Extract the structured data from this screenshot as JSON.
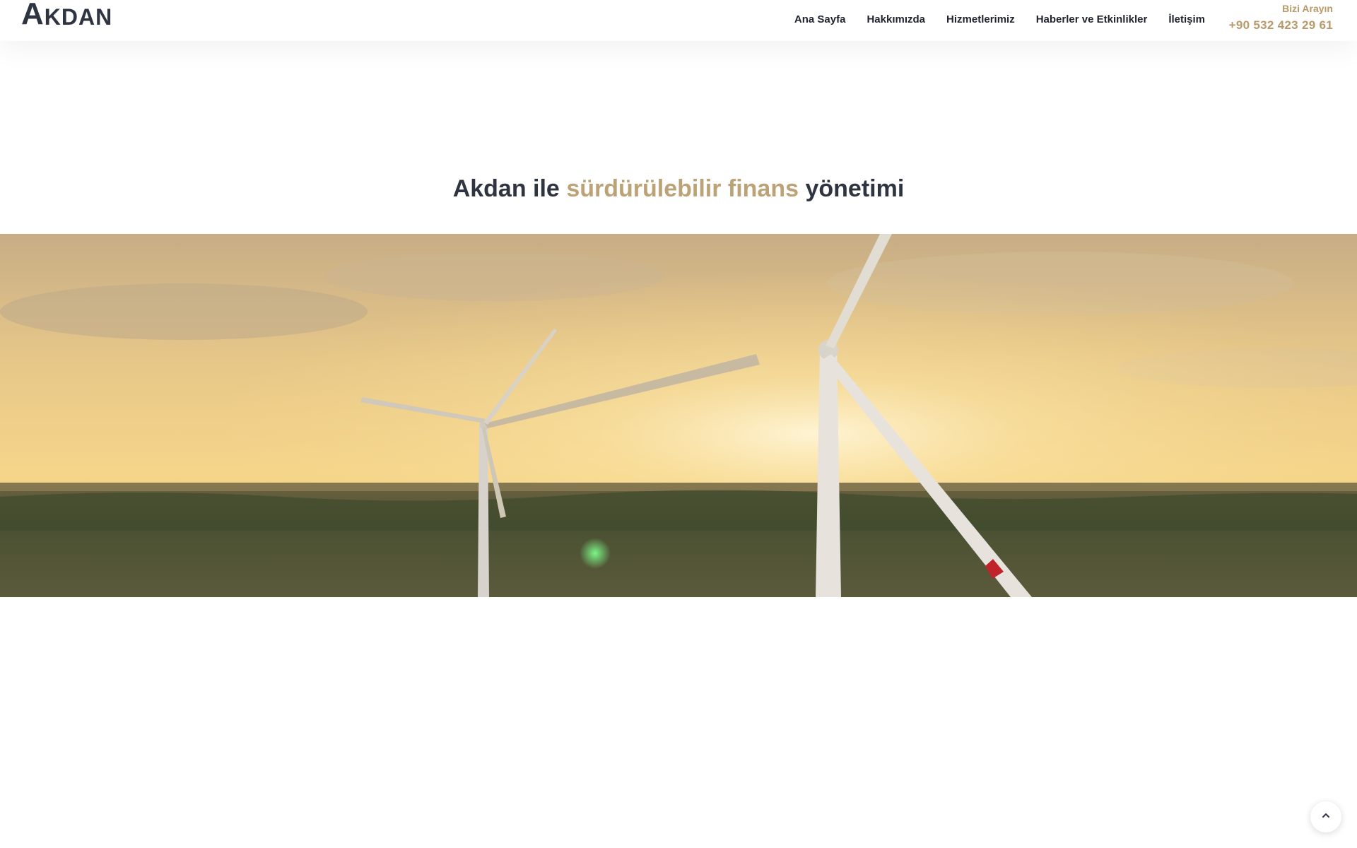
{
  "brand": {
    "logo_first": "A",
    "logo_rest": "KDAN"
  },
  "nav": {
    "items": [
      {
        "label": "Ana Sayfa"
      },
      {
        "label": "Hakkımızda"
      },
      {
        "label": "Hizmetlerimiz"
      },
      {
        "label": "Haberler ve Etkinlikler"
      },
      {
        "label": "İletişim"
      }
    ]
  },
  "contact": {
    "label": "Bizi Arayın",
    "phone": "+90 532 423 29 61"
  },
  "headline": {
    "part1": "Akdan ile",
    "accent": "sürdürülebilir finans",
    "part2": "yönetimi"
  },
  "colors": {
    "accent": "#bca377",
    "dark": "#2f3441"
  },
  "icons": {
    "back_to_top": "chevron-up-icon"
  }
}
